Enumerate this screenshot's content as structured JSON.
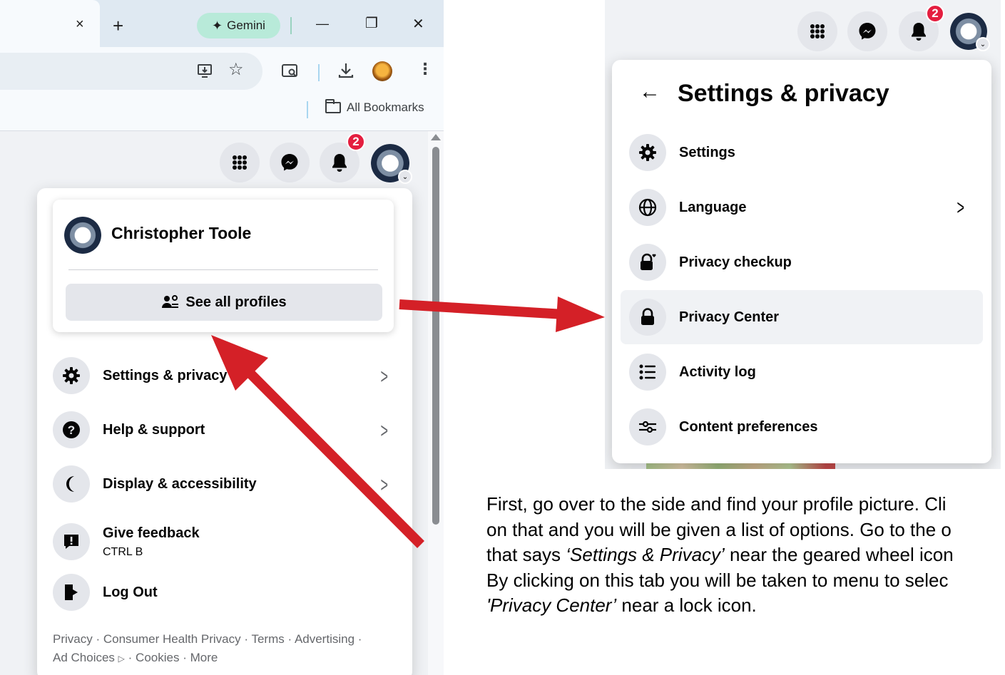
{
  "browser": {
    "tab_close": "×",
    "new_tab": "+",
    "gemini_label": "Gemini",
    "minimize": "—",
    "restore": "❐",
    "close": "✕",
    "bookmarks_label": "All Bookmarks"
  },
  "facebook": {
    "notification_count": "2",
    "account_menu": {
      "profile_name": "Christopher Toole",
      "see_all_profiles": "See all profiles",
      "items": [
        {
          "label": "Settings & privacy"
        },
        {
          "label": "Help & support"
        },
        {
          "label": "Display & accessibility"
        },
        {
          "label": "Give feedback",
          "sub": "CTRL B"
        },
        {
          "label": "Log Out"
        }
      ],
      "footer": [
        "Privacy",
        "Consumer Health Privacy",
        "Terms",
        "Advertising",
        "Ad Choices",
        "Cookies",
        "More"
      ],
      "footer_sep": "·"
    },
    "settings_panel": {
      "title": "Settings & privacy",
      "items": [
        {
          "label": "Settings"
        },
        {
          "label": "Language"
        },
        {
          "label": "Privacy checkup"
        },
        {
          "label": "Privacy Center"
        },
        {
          "label": "Activity log"
        },
        {
          "label": "Content preferences"
        }
      ]
    }
  },
  "caption": {
    "line1": "First, go over to the side and find your profile picture. Cli",
    "line2": "on that and you will be given a list of options. Go to the o",
    "line3_pre": "that says ",
    "line3_em": "‘Settings & Privacy’",
    "line3_post": " near the geared wheel icon",
    "line4": "By clicking on this tab you will be taken to menu to selec",
    "line5_em": "'Privacy Center’",
    "line5_post": " near a lock icon."
  },
  "colors": {
    "arrow": "#d42027",
    "notification_badge": "#e41e3f",
    "menu_icon_bg": "#e4e6eb",
    "gemini_bg": "#b8ead9"
  }
}
